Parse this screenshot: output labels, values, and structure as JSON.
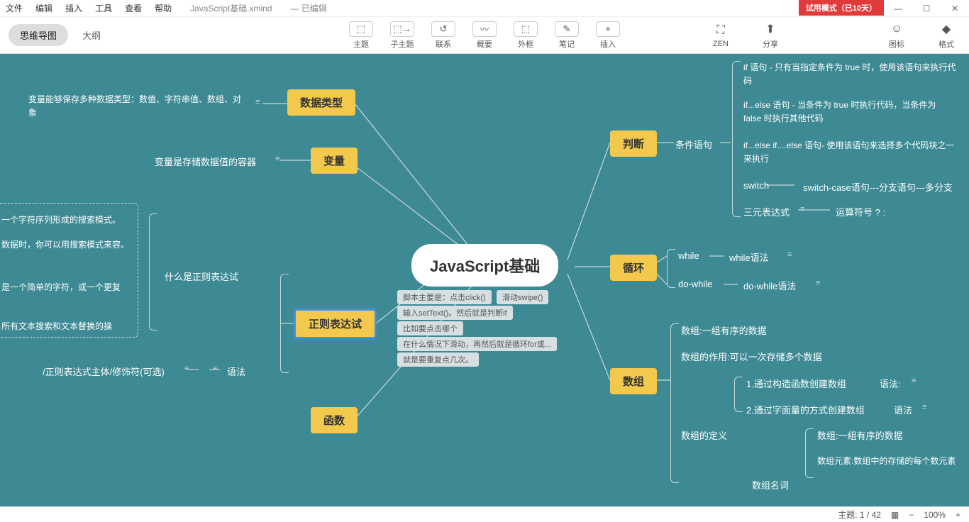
{
  "menu": {
    "file": "文件",
    "edit": "编辑",
    "insert": "插入",
    "tools": "工具",
    "view": "查看",
    "help": "帮助",
    "doc": "JavaScript基础.xmind",
    "state": "— 已编辑"
  },
  "trial": "试用模式（已10天）",
  "win": {
    "min": "—",
    "max": "☐",
    "close": "✕"
  },
  "tabs": {
    "mindmap": "思维导图",
    "outline": "大纲"
  },
  "tools": {
    "topic": "主题",
    "subtopic": "子主题",
    "relation": "联系",
    "summary": "概要",
    "boundary": "外框",
    "note": "笔记",
    "insert": "插入",
    "zen": "ZEN",
    "share": "分享",
    "icon": "图标",
    "format": "格式"
  },
  "ticons": {
    "topic": "⬚",
    "subtopic": "⬚→",
    "relation": "↺",
    "summary": "〰",
    "boundary": "⬚",
    "note": "✎",
    "insert": "+",
    "zen": "⛶",
    "share": "⬆",
    "icon": "☺",
    "format": "◆"
  },
  "root": "JavaScript基础",
  "tags": {
    "t1": "脚本主要是：点击click()",
    "t2": "滑动swipe()",
    "t3": "输入setText()。然后就是判断if",
    "t4": "比如要点击哪个",
    "t5": "在什么情况下滑动，再然后就是循环for或...",
    "t6": "就是要重复点几次。"
  },
  "nodes": {
    "datatype": "数据类型",
    "variable": "变量",
    "regex": "正则表达试",
    "func": "函数",
    "judge": "判断",
    "loop": "循环",
    "array": "数组"
  },
  "left": {
    "var_desc": "变量能够保存多种数据类型：数值、字符串值、数组、对象",
    "var_store": "变量是存储数据值的容器",
    "regex_what": "什么是正则表达试",
    "regex_syntax": "语法",
    "regex_pattern": "/正则表达式主体/修饰符(可选)",
    "box1": "一个字符序列形成的搜索模式。",
    "box2": "数据时，你可以用搜索模式来容。",
    "box3": "是一个简单的字符，或一个更复",
    "box4": "所有文本搜索和文本替换的操"
  },
  "right": {
    "cond": "条件语句",
    "if": "if 语句 - 只有当指定条件为 true 时，使用该语句来执行代码",
    "ifelse": "if...else 语句 - 当条件为 true 时执行代码，当条件为 false 时执行其他代码",
    "ifelseif": "if...else if....else 语句- 使用该语句来选择多个代码块之一来执行",
    "switch": "switch",
    "switch2": "switch-case语句---分支语句---多分支",
    "ternary": "三元表达式",
    "ternary2": "运算符号 ? :",
    "while": "while",
    "while2": "while语法",
    "dowhile": "do-while",
    "dowhile2": "do-while语法",
    "arr1": "数组:一组有序的数据",
    "arr2": "数组的作用:可以一次存储多个数据",
    "arrdef": "数组的定义",
    "arrc1": "1.通过构造函数创建数组",
    "arrc1b": "语法:",
    "arrc2": "2.通过字面量的方式创建数组",
    "arrc2b": "语法",
    "arrn": "数组名词",
    "arrn1": "数组:一组有序的数据",
    "arrn2": "数组元素:数组中的存储的每个数元素"
  },
  "status": {
    "topic": "主题: 1 / 42",
    "zoom": "100%"
  }
}
